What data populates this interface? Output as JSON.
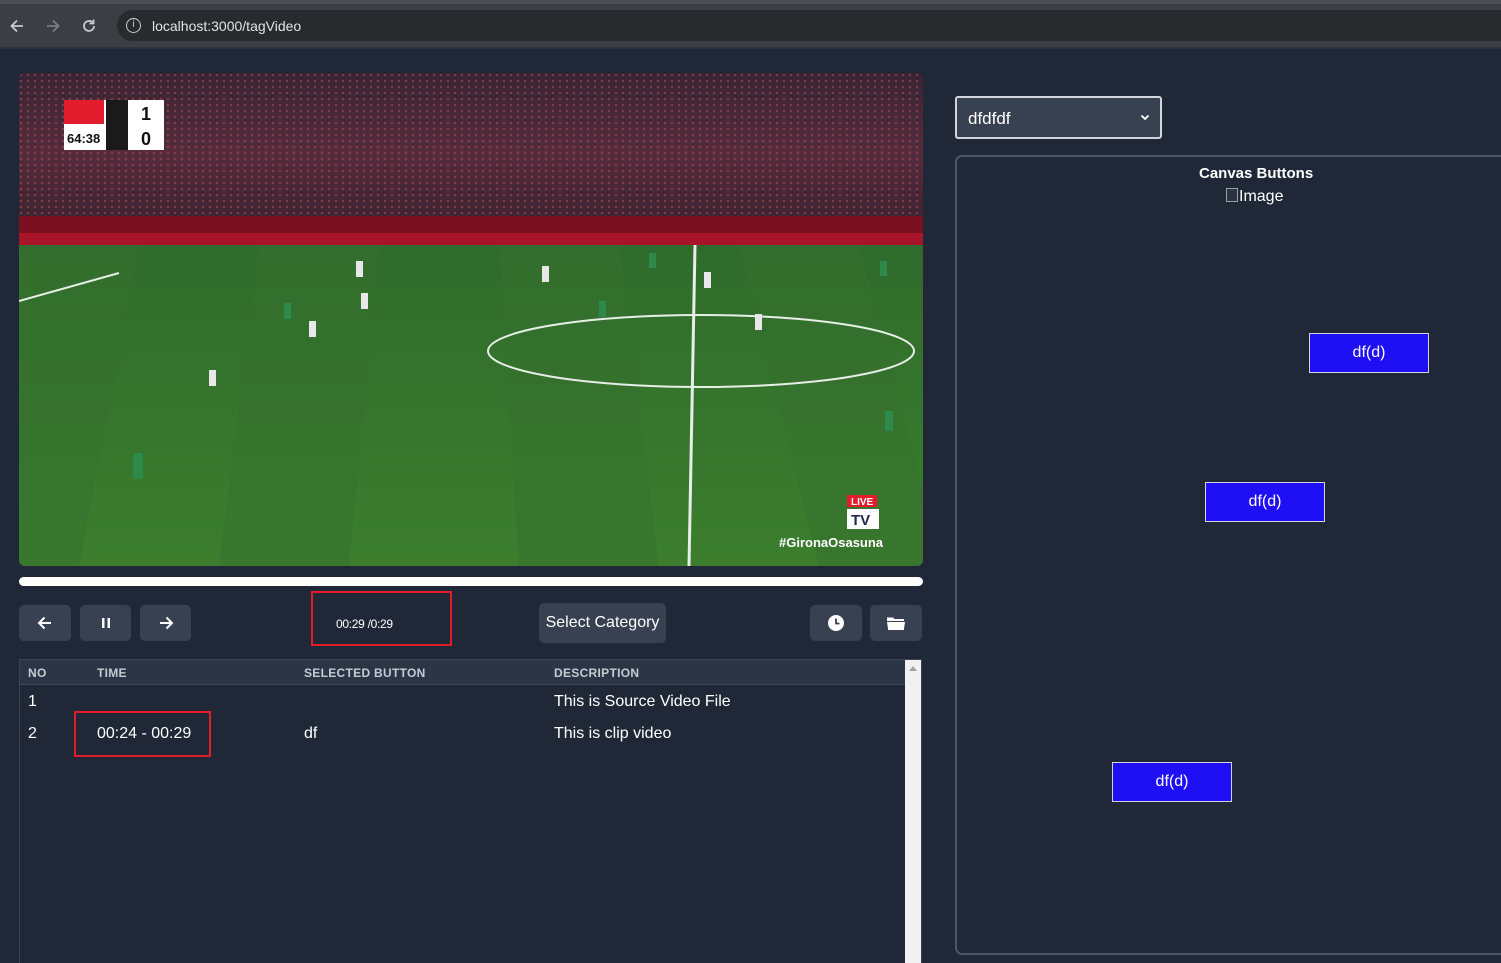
{
  "browser": {
    "url": "localhost:3000/tagVideo",
    "back_icon": "arrow-left-icon",
    "forward_icon": "arrow-right-icon",
    "reload_icon": "reload-icon",
    "info_icon": "info-icon"
  },
  "video": {
    "progress_fraction": 1.0,
    "scoreboard": {
      "time": "64:38",
      "home_score": "1",
      "away_score": "0"
    },
    "overlay_badge": "LIVE",
    "overlay_brand": "TV",
    "overlay_hashtag": "#GironaOsasuna"
  },
  "controls": {
    "time_display": "00:29 /0:29",
    "category_button": "Select Category",
    "prev_icon": "arrow-left-icon",
    "pause_icon": "pause-icon",
    "next_icon": "arrow-right-icon",
    "clock_icon": "clock-icon",
    "folder_icon": "folder-icon"
  },
  "table": {
    "headers": {
      "no": "NO",
      "time": "TIME",
      "selected_button": "SELECTED BUTTON",
      "description": "DESCRIPTION"
    },
    "rows": [
      {
        "no": "1",
        "time": "",
        "selected_button": "",
        "description": "This is Source Video File"
      },
      {
        "no": "2",
        "time": "00:24 - 00:29",
        "selected_button": "df",
        "description": "This is clip video"
      }
    ]
  },
  "right_panel": {
    "select_value": "dfdfdf",
    "canvas_title": "Canvas Buttons",
    "image_alt": "Image",
    "buttons": [
      "df(d)",
      "df(d)",
      "df(d)"
    ]
  },
  "colors": {
    "background": "#202837",
    "control_bg": "#374151",
    "canvas_button": "#1e0ff5",
    "highlight_red": "#e11d2a"
  }
}
